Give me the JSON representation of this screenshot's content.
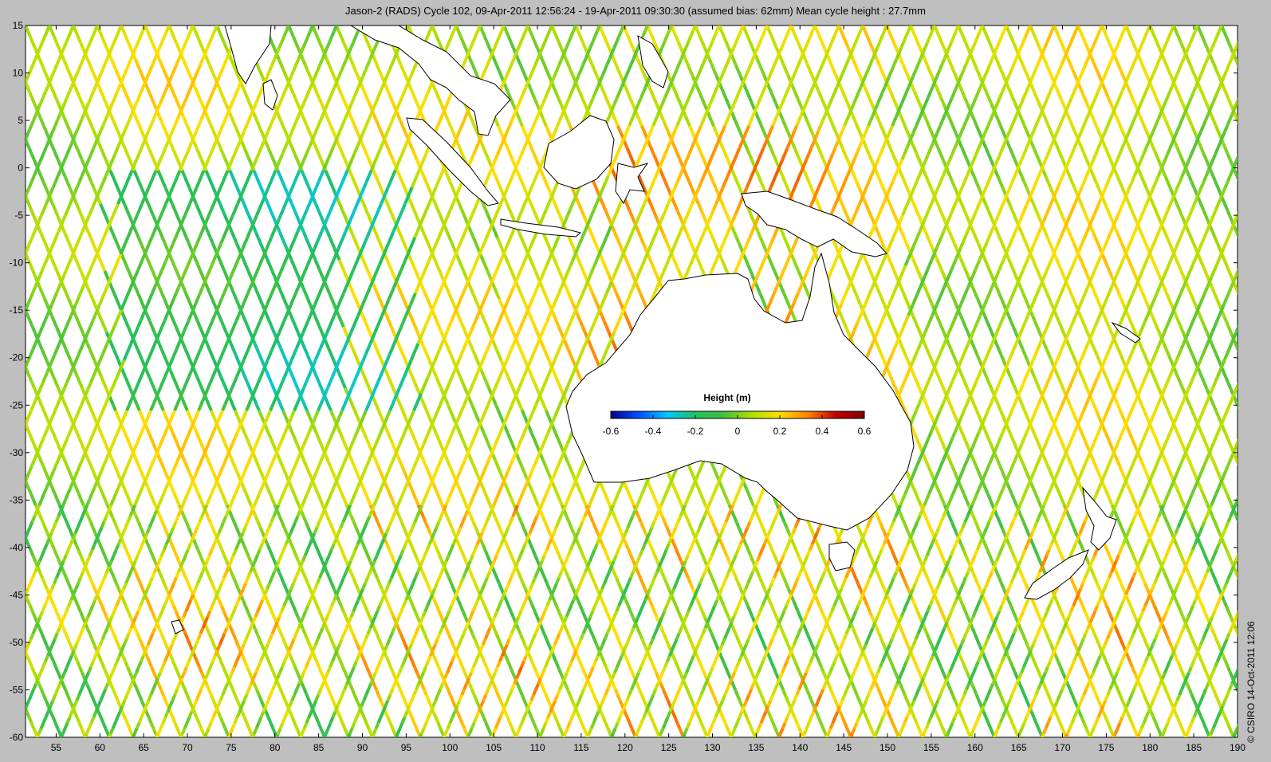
{
  "title": "Jason-2 (RADS) Cycle 102, 09-Apr-2011 12:56:24 - 19-Apr-2011 09:30:30 (assumed bias: 62mm)  Mean cycle height : 27.7mm",
  "credit": "© CSIRO 14-Oct-2011 12:06",
  "colorbar": {
    "label": "Height (m)",
    "ticks": [
      "-0.6",
      "-0.4",
      "-0.2",
      "0",
      "0.2",
      "0.4",
      "0.6"
    ],
    "range": [
      -0.6,
      0.6
    ],
    "colors": [
      "#00008f",
      "#0050ff",
      "#00c8ff",
      "#20c060",
      "#40c040",
      "#b0e000",
      "#ffe000",
      "#ff8000",
      "#c00000",
      "#800000"
    ]
  },
  "axes": {
    "lon_ticks": [
      "55",
      "60",
      "65",
      "70",
      "75",
      "80",
      "85",
      "90",
      "95",
      "100",
      "105",
      "110",
      "115",
      "120",
      "125",
      "130",
      "135",
      "140",
      "145",
      "150",
      "155",
      "160",
      "165",
      "170",
      "175",
      "180",
      "185",
      "190"
    ],
    "lat_ticks": [
      "15",
      "10",
      "5",
      "0",
      "-5",
      "-10",
      "-15",
      "-20",
      "-25",
      "-30",
      "-35",
      "-40",
      "-45",
      "-50",
      "-55",
      "-60"
    ],
    "lon_range": [
      51.5,
      190
    ],
    "lat_range": [
      -60,
      15
    ]
  },
  "ocean_background": "#ffffff",
  "land_outline": "#000000"
}
